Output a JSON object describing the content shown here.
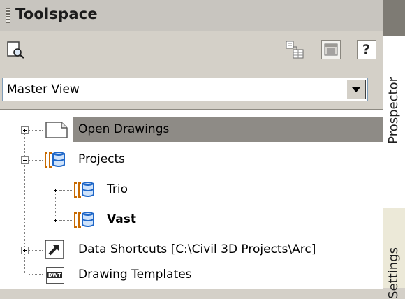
{
  "window": {
    "title": "Toolspace"
  },
  "tabs": [
    {
      "label": "Prospector"
    },
    {
      "label": "Settings"
    }
  ],
  "toolbar": {
    "items": [
      {
        "icon": "drawing-search-icon"
      },
      {
        "icon": "copy-to-project-icon"
      },
      {
        "icon": "item-view-icon"
      },
      {
        "icon": "help-icon",
        "glyph": "?"
      }
    ]
  },
  "view_selector": {
    "value": "Master View"
  },
  "tree": {
    "open_drawings": {
      "label": "Open Drawings",
      "selected": true
    },
    "projects": {
      "label": "Projects",
      "expanded": true
    },
    "trio": {
      "label": "Trio"
    },
    "vast": {
      "label": "Vast",
      "bold": true
    },
    "data_shortcuts": {
      "label": "Data Shortcuts [C:\\Civil 3D Projects\\Arc]"
    },
    "drawing_templates": {
      "label": "Drawing Templates",
      "icon_text": "DWT"
    }
  }
}
